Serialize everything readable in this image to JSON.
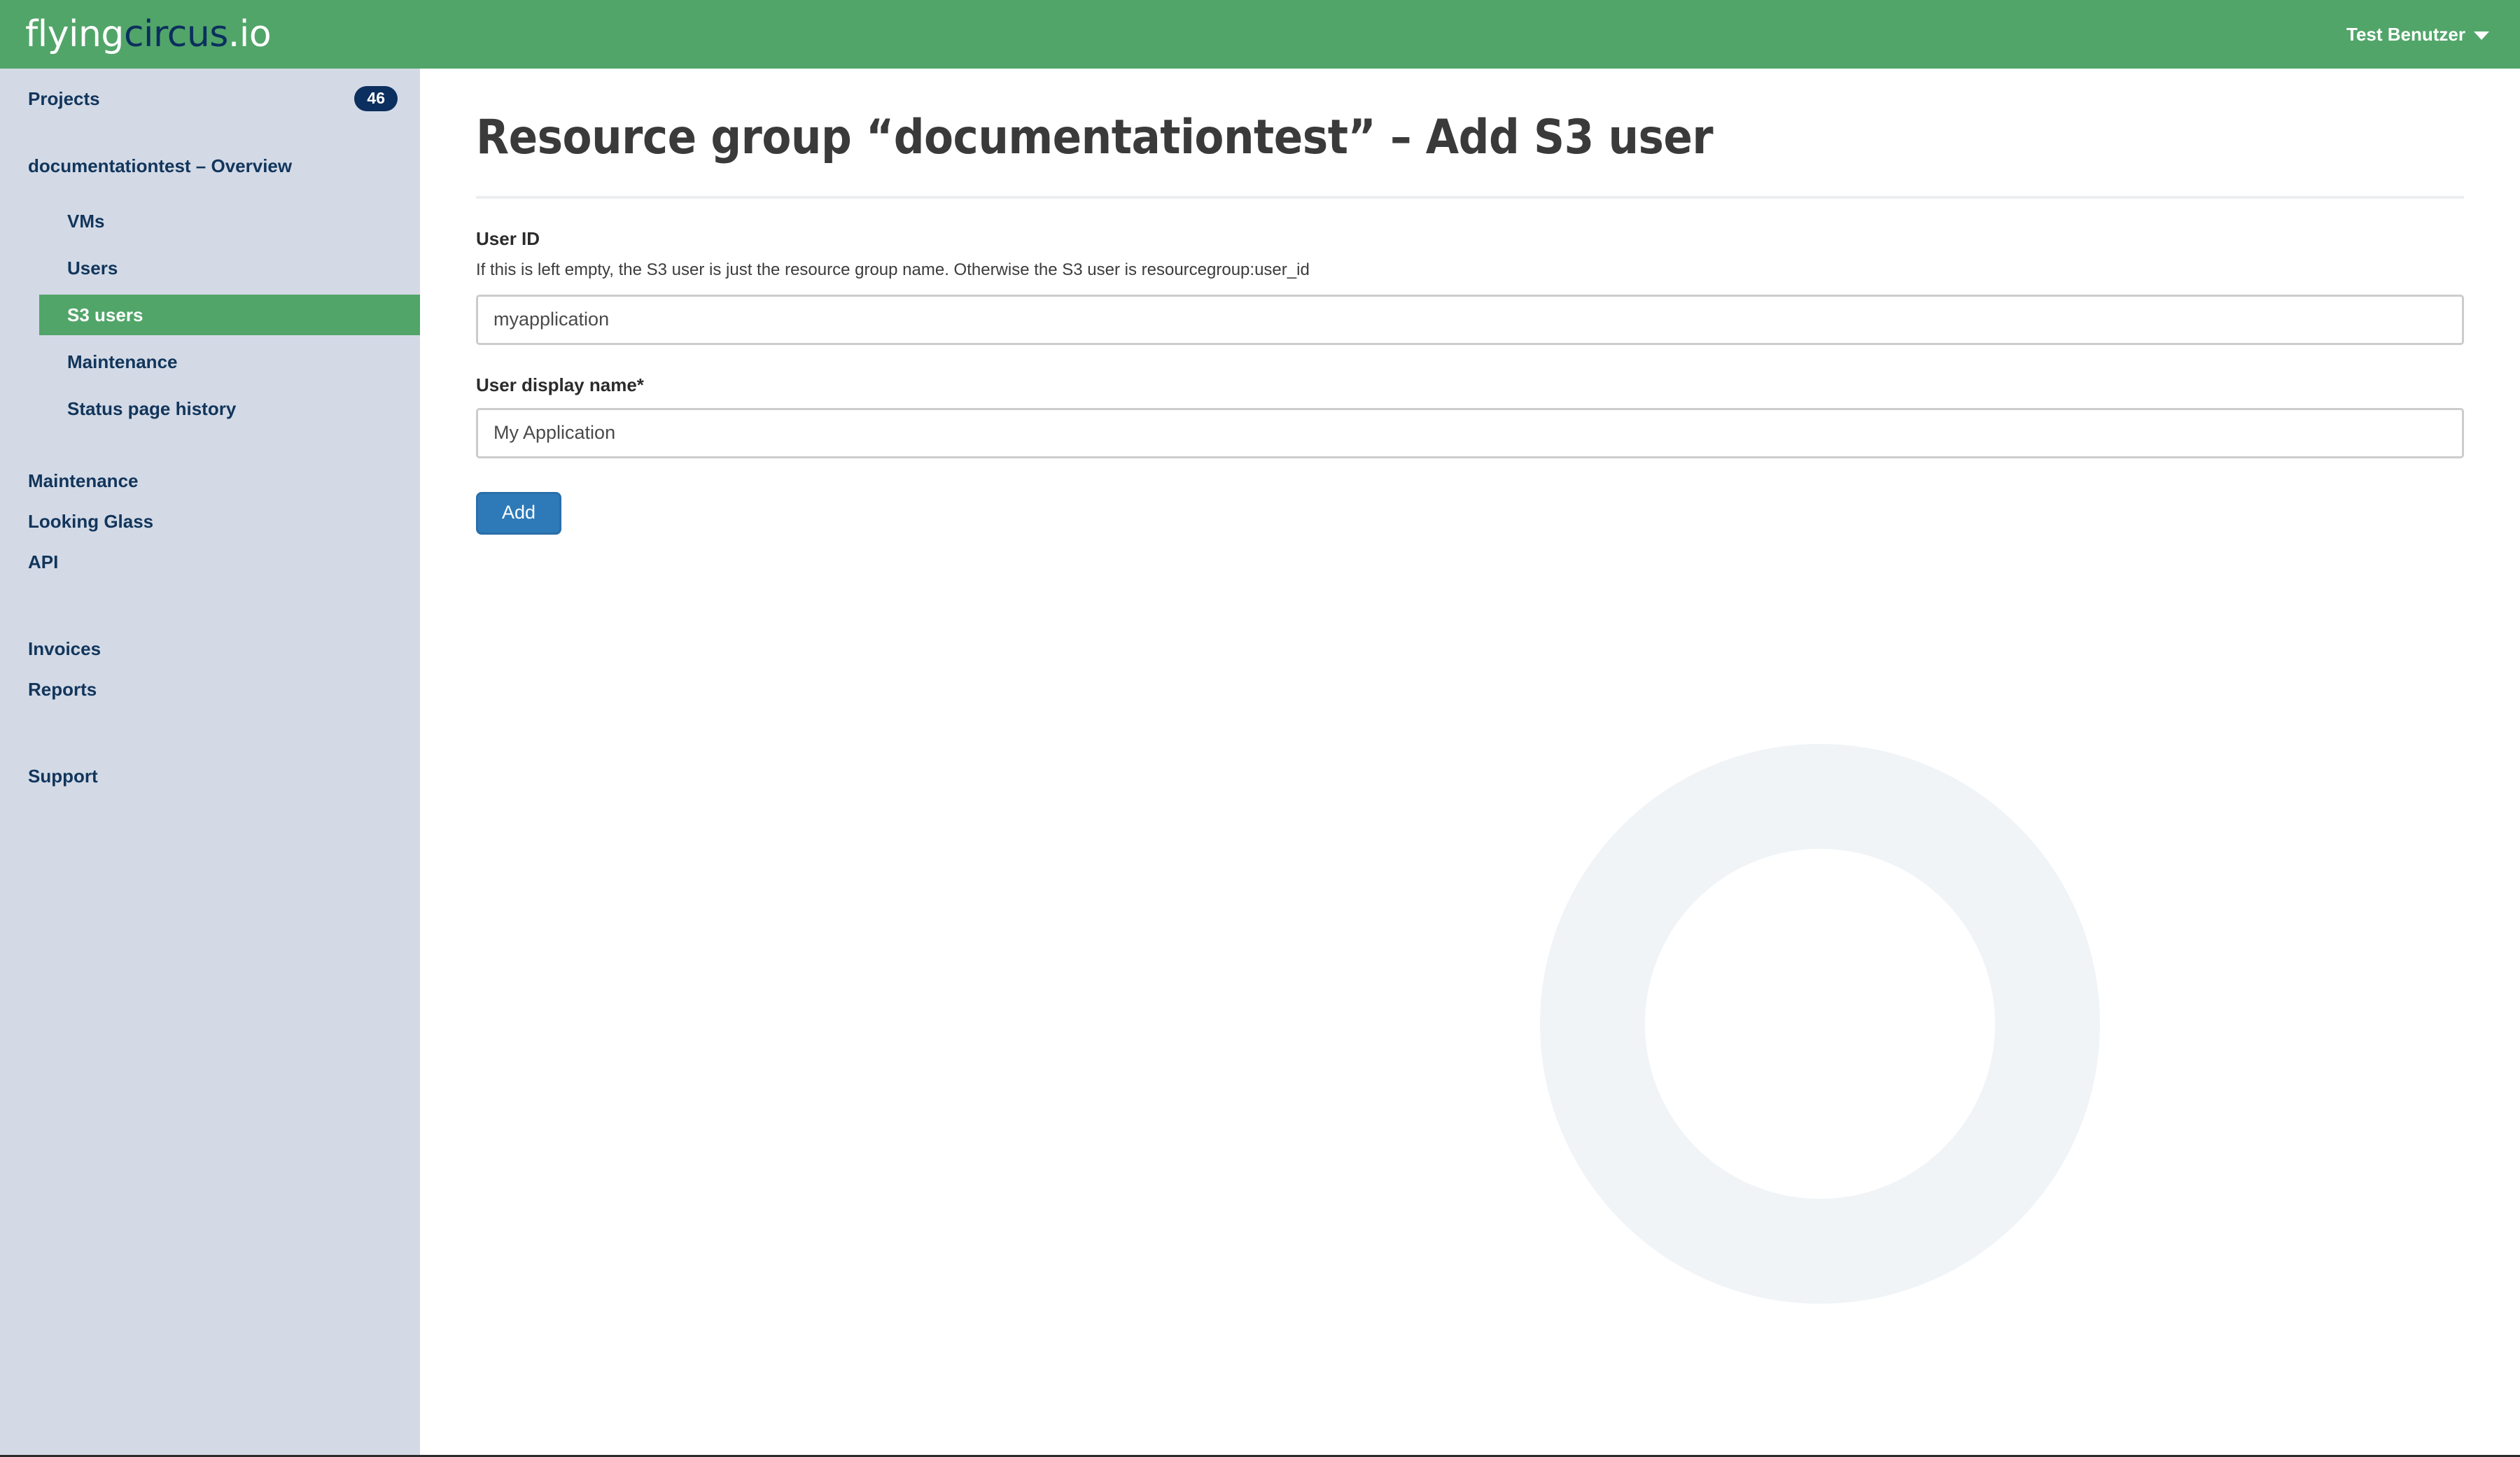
{
  "colors": {
    "brand_green": "#51a569",
    "sidebar_bg": "#d3dae6",
    "navy": "#12355b",
    "badge_bg": "#0b2f5e",
    "button_blue": "#2e7ab8",
    "ring": "#f0f4f7"
  },
  "header": {
    "logo_part1": "flying",
    "logo_part2": "circus",
    "logo_part3": ".io",
    "user_name": "Test Benutzer",
    "caret_icon": "chevron-down-icon"
  },
  "sidebar": {
    "projects": {
      "label": "Projects",
      "count": "46"
    },
    "project_overview": "documentationtest – Overview",
    "project_items": [
      {
        "label": "VMs",
        "active": false
      },
      {
        "label": "Users",
        "active": false
      },
      {
        "label": "S3 users",
        "active": true
      },
      {
        "label": "Maintenance",
        "active": false
      },
      {
        "label": "Status page history",
        "active": false
      }
    ],
    "global_items": [
      {
        "label": "Maintenance"
      },
      {
        "label": "Looking Glass"
      },
      {
        "label": "API"
      }
    ],
    "billing_items": [
      {
        "label": "Invoices"
      },
      {
        "label": "Reports"
      }
    ],
    "support_items": [
      {
        "label": "Support"
      }
    ]
  },
  "main": {
    "page_title": "Resource group “documentationtest” – Add S3 user",
    "fields": {
      "user_id": {
        "label": "User ID",
        "help": "If this is left empty, the S3 user is just the resource group name. Otherwise the S3 user is resourcegroup:user_id",
        "value": "myapplication",
        "placeholder": "myapplication"
      },
      "display_name": {
        "label": "User display name*",
        "value": "My Application",
        "placeholder": "My Application"
      }
    },
    "submit_label": "Add"
  }
}
